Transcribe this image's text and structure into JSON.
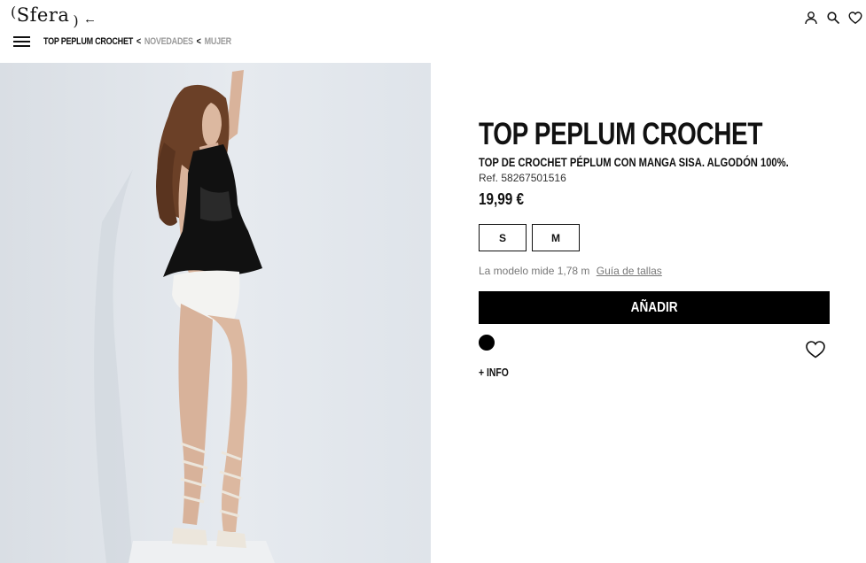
{
  "header": {
    "logo_open": "(",
    "logo_text": "Sfera",
    "logo_close": ")",
    "back_glyph": "←",
    "breadcrumb": {
      "current": "TOP PEPLUM CROCHET",
      "sep1": "<",
      "link1": "NOVEDADES",
      "sep2": "<",
      "link2": "MUJER"
    },
    "icons": [
      "user-icon",
      "search-icon",
      "heart-icon"
    ]
  },
  "product": {
    "title": "TOP PEPLUM CROCHET",
    "description": "TOP DE CROCHET PÉPLUM CON MANGA SISA. ALGODÓN 100%.",
    "ref": "Ref. 58267501516",
    "price": "19,99 €",
    "sizes": [
      "S",
      "M"
    ],
    "model_text": "La modelo mide 1,78 m",
    "size_guide": "Guía de tallas",
    "add_button": "AÑADIR",
    "color": "#000000",
    "info_link": "+ INFO"
  },
  "colors": {
    "accent": "#000000",
    "muted": "#9a9a9a",
    "photo_bg": "#e4e8ec"
  }
}
